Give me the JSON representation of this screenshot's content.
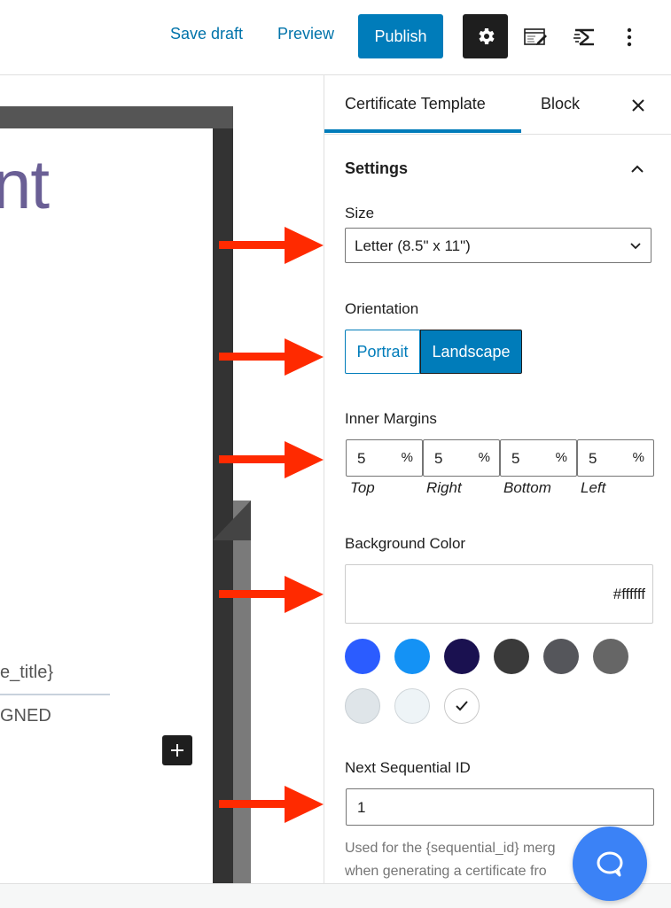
{
  "toolbar": {
    "save_draft": "Save draft",
    "preview": "Preview",
    "publish": "Publish",
    "settings_icon": "gear-icon",
    "editor_icon": "edit-template-icon",
    "brand_icon": "lifter-icon",
    "more_icon": "vertical-dots-icon"
  },
  "canvas": {
    "title_fragment": "nt",
    "field_fragment": "e_title}",
    "signed_fragment": "GNED",
    "add_block_icon": "plus-icon"
  },
  "sidebar": {
    "tabs": [
      {
        "label": "Certificate Template",
        "active": true
      },
      {
        "label": "Block",
        "active": false
      }
    ],
    "close_icon": "close-icon",
    "panel_title": "Settings",
    "size": {
      "label": "Size",
      "value": "Letter (8.5\" x 11\")"
    },
    "orientation": {
      "label": "Orientation",
      "options": [
        "Portrait",
        "Landscape"
      ],
      "selected": "Landscape"
    },
    "margins": {
      "label": "Inner Margins",
      "unit": "%",
      "fields": [
        {
          "caption": "Top",
          "value": "5"
        },
        {
          "caption": "Right",
          "value": "5"
        },
        {
          "caption": "Bottom",
          "value": "5"
        },
        {
          "caption": "Left",
          "value": "5"
        }
      ]
    },
    "background": {
      "label": "Background Color",
      "value": "#ffffff",
      "swatches": [
        "#2b5cff",
        "#1492f5",
        "#1a1150",
        "#3a3a3a",
        "#55565b",
        "#666666",
        "#dfe5e9",
        "#eef4f7",
        "#ffffff"
      ],
      "selected_index": 8
    },
    "sequential": {
      "label": "Next Sequential ID",
      "value": "1",
      "help_line1": "Used for the {sequential_id} merg",
      "help_line2": "when generating a certificate fro"
    }
  },
  "colors": {
    "accent": "#007cba",
    "arrow": "#ff2a00",
    "chat": "#3b82f6"
  }
}
